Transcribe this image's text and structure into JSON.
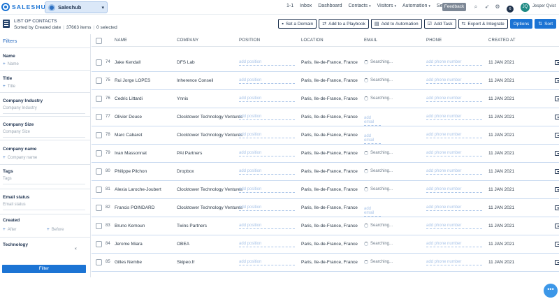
{
  "app": {
    "logo_text": "SALESHUB",
    "workspace": "Saleshub"
  },
  "nav": [
    {
      "label": "1-1",
      "chevron": false
    },
    {
      "label": "Inbox",
      "chevron": false
    },
    {
      "label": "Dashboard",
      "chevron": false
    },
    {
      "label": "Contacts",
      "chevron": true
    },
    {
      "label": "Visitors",
      "chevron": true
    },
    {
      "label": "Automation",
      "chevron": true
    },
    {
      "label": "Sequences",
      "chevron": true
    }
  ],
  "feedback_label": "Feedback",
  "notifications_count": "6",
  "user": {
    "initials": "JQ",
    "name": "Jesper Qvist"
  },
  "list": {
    "title": "LIST OF CONTACTS",
    "sort_text": "Sorted by Created date",
    "count_text": "37663 items",
    "selected_text": "0 selected"
  },
  "actions": [
    {
      "label": "Set a Domain",
      "icon": "domain-icon",
      "glyph": "▪"
    },
    {
      "label": "Add to a Playbook",
      "icon": "playbook-icon",
      "glyph": "⇄"
    },
    {
      "label": "Add to Automation",
      "icon": "automation-icon",
      "glyph": "▤"
    },
    {
      "label": "Add Task",
      "icon": "task-icon",
      "glyph": "☑"
    },
    {
      "label": "Export & Integrate",
      "icon": "export-icon",
      "glyph": "⇆"
    },
    {
      "label": "Options",
      "icon": "",
      "glyph": ""
    },
    {
      "label": "Sort",
      "icon": "sort-icon",
      "glyph": "⇅"
    }
  ],
  "filters": {
    "title": "Filters",
    "name": {
      "label": "Name",
      "placeholder": "Name"
    },
    "title_field": {
      "label": "Title",
      "placeholder": "Title"
    },
    "company_industry": {
      "label": "Company Industry",
      "placeholder": "Company Industry"
    },
    "company_size": {
      "label": "Company Size",
      "placeholder": "Company Size"
    },
    "company_name": {
      "label": "Company name",
      "placeholder": "Company name"
    },
    "tags": {
      "label": "Tags",
      "placeholder": "Tags"
    },
    "email_status": {
      "label": "Email status",
      "placeholder": "Email status"
    },
    "created": {
      "label": "Created",
      "after": "After",
      "before": "Before"
    },
    "technology": {
      "label": "Technology",
      "clear": "×"
    },
    "button_label": "Filter"
  },
  "columns": [
    "NAME",
    "COMPANY",
    "POSITION",
    "LOCATION",
    "EMAIL",
    "PHONE",
    "CREATED AT"
  ],
  "placeholders": {
    "position": "add position",
    "email": "add email",
    "phone": "add phone number",
    "searching": "Searching..."
  },
  "rows": [
    {
      "idx": "74",
      "name": "Jake Kendall",
      "company": "DFS Lab",
      "location": "Paris, Ile-de-France, France",
      "email": "searching",
      "created": "11 JAN 2021"
    },
    {
      "idx": "75",
      "name": "Rui Jorge LOPES",
      "company": "Inherence Conseil",
      "location": "Paris, Ile-de-France, France",
      "email": "searching",
      "created": "11 JAN 2021"
    },
    {
      "idx": "76",
      "name": "Cedric Littardi",
      "company": "Ynnis",
      "location": "Paris, Ile-de-France, France",
      "email": "searching",
      "created": "11 JAN 2021"
    },
    {
      "idx": "77",
      "name": "Olivier Douce",
      "company": "Clocktower Technology Ventures",
      "location": "Paris, Ile-de-France, France",
      "email": "add",
      "created": "11 JAN 2021"
    },
    {
      "idx": "78",
      "name": "Marc Cabaret",
      "company": "Clocktower Technology Ventures",
      "location": "Paris, Ile-de-France, France",
      "email": "add",
      "created": "11 JAN 2021"
    },
    {
      "idx": "79",
      "name": "Ivan Massonnat",
      "company": "PAI Partners",
      "location": "Paris, Ile-de-France, France",
      "email": "searching",
      "created": "11 JAN 2021"
    },
    {
      "idx": "80",
      "name": "Philippe Pilchon",
      "company": "Dropbox",
      "location": "Paris, Ile-de-France, France",
      "email": "searching",
      "created": "11 JAN 2021"
    },
    {
      "idx": "81",
      "name": "Alexia Laroche-Joubert",
      "company": "Clocktower Technology Ventures",
      "location": "Paris, Ile-de-France, France",
      "email": "searching",
      "created": "11 JAN 2021"
    },
    {
      "idx": "82",
      "name": "Francis POINDARD",
      "company": "Clocktower Technology Ventures",
      "location": "Paris, Ile-de-France, France",
      "email": "add",
      "created": "11 JAN 2021"
    },
    {
      "idx": "83",
      "name": "Bruno Kemoun",
      "company": "Twins Partners",
      "location": "Paris, Ile-de-France, France",
      "email": "searching",
      "created": "11 JAN 2021"
    },
    {
      "idx": "84",
      "name": "Jerome Miara",
      "company": "OBEA",
      "location": "Paris, Ile-de-France, France",
      "email": "searching",
      "created": "11 JAN 2021"
    },
    {
      "idx": "85",
      "name": "Gilles Nembe",
      "company": "Skipeo.fr",
      "location": "Paris, Ile-de-France, France",
      "email": "searching",
      "created": "11 JAN 2021"
    }
  ],
  "colors": {
    "primary": "#1c74d4",
    "dark": "#1f3350",
    "accent_link": "#a9c4e8"
  }
}
